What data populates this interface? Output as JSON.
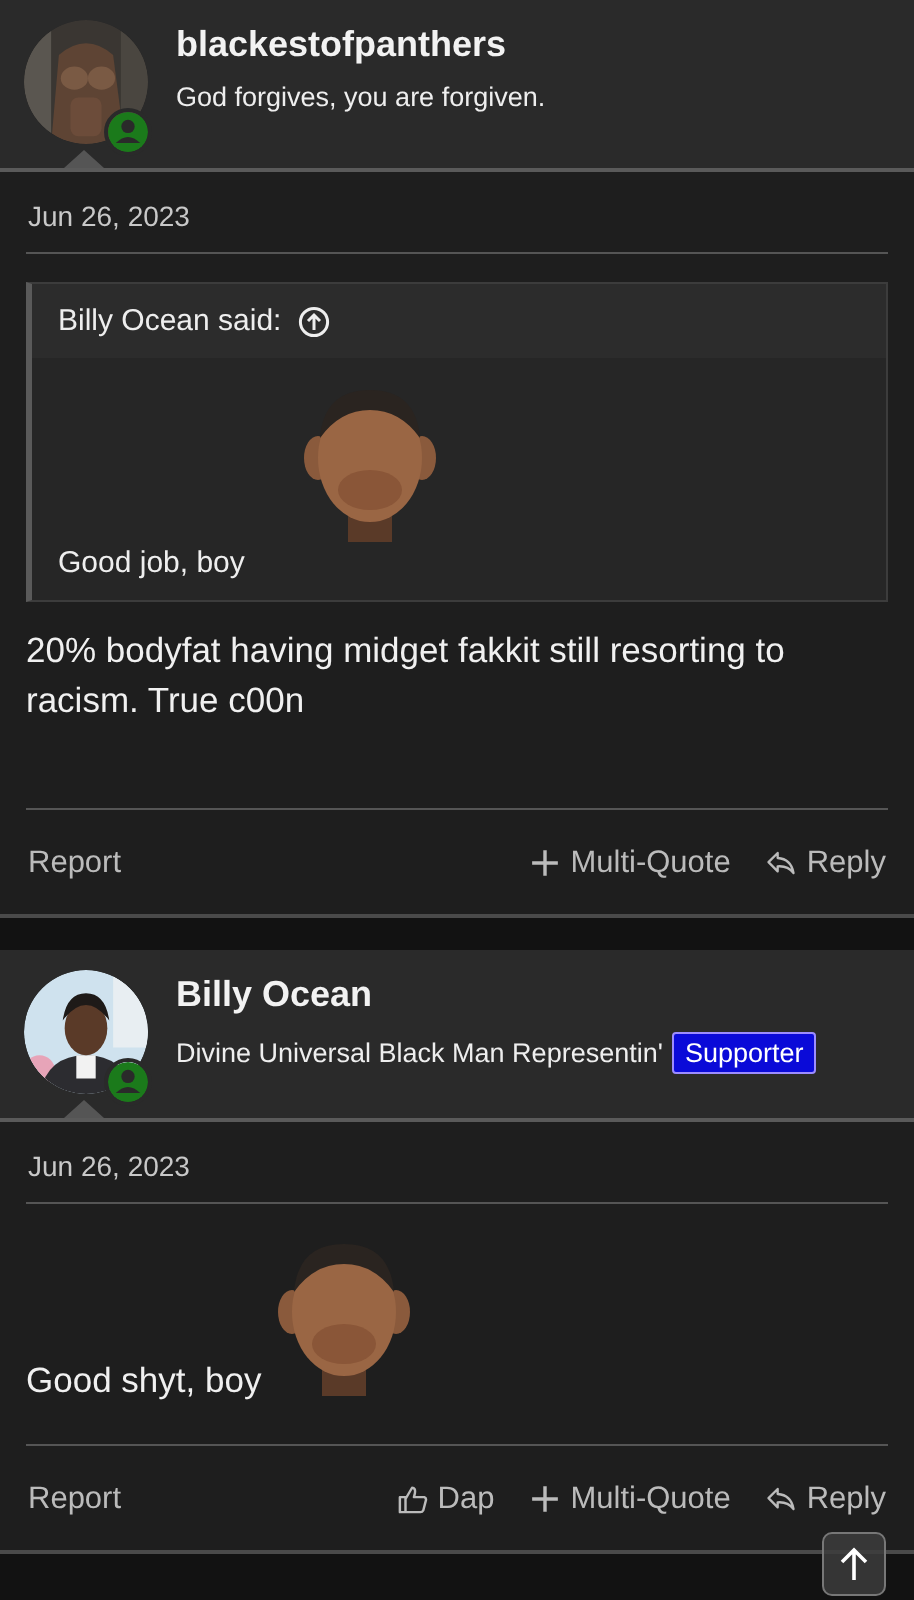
{
  "posts": [
    {
      "author": {
        "name": "blackestofpanthers",
        "title": "God forgives, you are forgiven.",
        "online": true
      },
      "date": "Jun 26, 2023",
      "quote": {
        "header": "Billy Ocean said:",
        "text": "Good job, boy"
      },
      "message": {
        "text": "20% bodyfat having midget fakkit still resorting to racism. True c00n"
      },
      "actions": [
        {
          "kind": "report",
          "label": "Report"
        },
        {
          "kind": "multiquote",
          "label": "Multi-Quote"
        },
        {
          "kind": "reply",
          "label": "Reply"
        }
      ]
    },
    {
      "author": {
        "name": "Billy Ocean",
        "title": "Divine Universal Black Man Representin'",
        "banner": "Supporter",
        "online": true
      },
      "date": "Jun 26, 2023",
      "message": {
        "text": "Good shyt, boy"
      },
      "actions": [
        {
          "kind": "report",
          "label": "Report"
        },
        {
          "kind": "dap",
          "label": "Dap"
        },
        {
          "kind": "multiquote",
          "label": "Multi-Quote"
        },
        {
          "kind": "reply",
          "label": "Reply"
        }
      ]
    }
  ],
  "scroll_top": true
}
